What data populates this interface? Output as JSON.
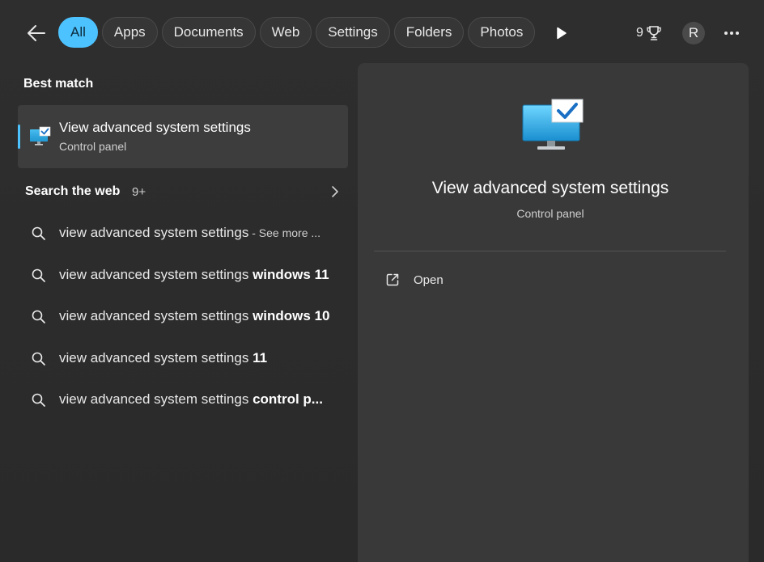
{
  "nav": {
    "back_icon": "arrow-left-icon",
    "filters": [
      {
        "label": "All",
        "active": true
      },
      {
        "label": "Apps",
        "active": false
      },
      {
        "label": "Documents",
        "active": false
      },
      {
        "label": "Web",
        "active": false
      },
      {
        "label": "Settings",
        "active": false
      },
      {
        "label": "Folders",
        "active": false
      },
      {
        "label": "Photos",
        "active": false
      }
    ],
    "more_filters_icon": "play-icon",
    "rewards_points": "9",
    "rewards_icon": "trophy-icon",
    "avatar_initial": "R",
    "more_icon": "ellipsis-icon"
  },
  "best_match": {
    "heading": "Best match",
    "title": "View advanced system settings",
    "subtitle": "Control panel",
    "icon": "monitor-check-icon"
  },
  "web": {
    "heading": "Search the web",
    "count": "9+",
    "suggestions": [
      {
        "prefix": "view advanced system settings",
        "bold": "",
        "hint": " - See more ..."
      },
      {
        "prefix": "view advanced system settings ",
        "bold": "windows 11",
        "hint": ""
      },
      {
        "prefix": "view advanced system settings ",
        "bold": "windows 10",
        "hint": ""
      },
      {
        "prefix": "view advanced system settings ",
        "bold": "11",
        "hint": ""
      },
      {
        "prefix": "view advanced system settings ",
        "bold": "control p...",
        "hint": ""
      }
    ]
  },
  "preview": {
    "title": "View advanced system settings",
    "subtitle": "Control panel",
    "icon": "monitor-check-icon",
    "actions": [
      {
        "label": "Open",
        "icon": "open-external-icon"
      }
    ]
  },
  "colors": {
    "accent": "#4cc2ff",
    "background": "#2b2b2b",
    "pane": "#393939"
  }
}
